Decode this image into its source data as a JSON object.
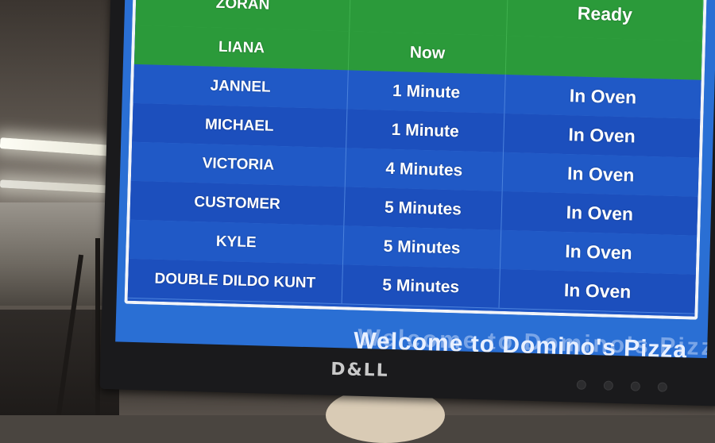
{
  "monitor": {
    "brand": "D&LL"
  },
  "board": {
    "rows": [
      {
        "name": "ZORAN",
        "time": "",
        "status": "Ready",
        "state": "done"
      },
      {
        "name": "LIANA",
        "time": "Now",
        "status": "",
        "state": "done"
      },
      {
        "name": "JANNEL",
        "time": "1 Minute",
        "status": "In Oven",
        "state": "oven"
      },
      {
        "name": "MICHAEL",
        "time": "1 Minute",
        "status": "In Oven",
        "state": "oven"
      },
      {
        "name": "VICTORIA",
        "time": "4 Minutes",
        "status": "In Oven",
        "state": "oven"
      },
      {
        "name": "CUSTOMER",
        "time": "5 Minutes",
        "status": "In Oven",
        "state": "oven"
      },
      {
        "name": "KYLE",
        "time": "5 Minutes",
        "status": "In Oven",
        "state": "oven"
      },
      {
        "name": "DOUBLE DILDO KUNT",
        "time": "5 Minutes",
        "status": "In Oven",
        "state": "oven"
      }
    ],
    "ticker": "Welcome to Domino's Pizza"
  },
  "colors": {
    "ready_green": "#2b9a3a",
    "oven_blue": "#2059c6",
    "screen_blue": "#2a6fd4"
  }
}
